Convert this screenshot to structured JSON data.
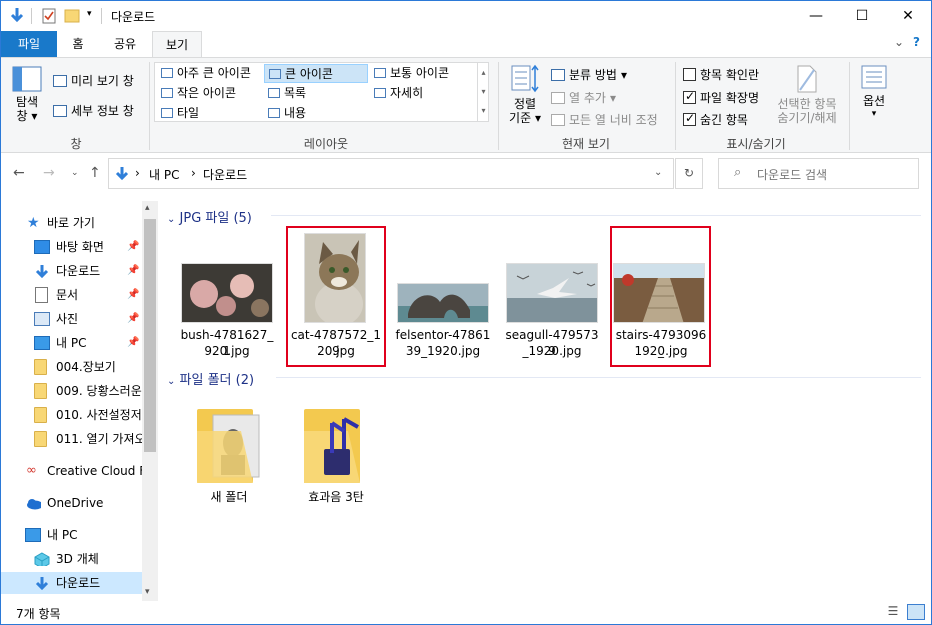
{
  "window": {
    "title": "다운로드",
    "minimize": "—",
    "maximize": "☐",
    "close": "✕"
  },
  "tabs": [
    "파일",
    "홈",
    "공유",
    "보기"
  ],
  "ribbon": {
    "pane": {
      "nav_pane_line1": "탐색",
      "nav_pane_line2": "창",
      "preview": "미리 보기 창",
      "details": "세부 정보 창",
      "label": "창"
    },
    "layout": {
      "items": [
        "아주 큰 아이콘",
        "큰 아이콘",
        "보통 아이콘",
        "작은 아이콘",
        "목록",
        "자세히",
        "타일",
        "내용"
      ],
      "label": "레이아웃"
    },
    "view": {
      "sort_line1": "정렬",
      "sort_line2": "기준",
      "group_by": "분류 방법",
      "add_columns": "열 추가",
      "fit_columns": "모든 열 너비 조정",
      "label": "현재 보기"
    },
    "showhide": {
      "item_checkboxes": "항목 확인란",
      "file_extensions": "파일 확장명",
      "hidden_items": "숨긴 항목",
      "hide_selected_line1": "선택한 항목",
      "hide_selected_line2": "숨기기/해제",
      "label": "표시/숨기기"
    },
    "options": "옵션"
  },
  "address": {
    "segments": [
      "내 PC",
      "다운로드"
    ],
    "separator": "›",
    "search_placeholder": "다운로드 검색"
  },
  "navpane": {
    "items": [
      {
        "label": "바로 가기",
        "icon": "star-icon"
      },
      {
        "label": "바탕 화면",
        "icon": "desktop-icon",
        "pinned": true
      },
      {
        "label": "다운로드",
        "icon": "download-icon",
        "pinned": true
      },
      {
        "label": "문서",
        "icon": "document-icon",
        "pinned": true
      },
      {
        "label": "사진",
        "icon": "pictures-icon",
        "pinned": true
      },
      {
        "label": "내 PC",
        "icon": "pc-icon",
        "pinned": true
      },
      {
        "label": "004.장보기",
        "icon": "folder-icon"
      },
      {
        "label": "009. 당황스러운",
        "icon": "folder-icon"
      },
      {
        "label": "010. 사전설정저",
        "icon": "folder-icon"
      },
      {
        "label": "011. 열기 가져오",
        "icon": "folder-icon"
      },
      {
        "label": "Creative Cloud Fil",
        "icon": "creative-cloud-icon"
      },
      {
        "label": "OneDrive",
        "icon": "onedrive-icon"
      },
      {
        "label": "내 PC",
        "icon": "pc-icon"
      },
      {
        "label": "3D 개체",
        "icon": "cube-icon"
      },
      {
        "label": "다운로드",
        "icon": "download-icon"
      }
    ]
  },
  "groups": {
    "jpg_header": "JPG 파일 (5)",
    "folder_header": "파일 폴더 (2)"
  },
  "files": [
    {
      "name": "bush-4781627_1920.jpg",
      "line1": "bush-4781627_1",
      "line2": "920.jpg",
      "highlight": false
    },
    {
      "name": "cat-4787572_1920.jpg",
      "line1": "cat-4787572_19",
      "line2": "20.jpg",
      "highlight": true
    },
    {
      "name": "felsentor-4786139_1920.jpg",
      "line1": "felsentor-47861",
      "line2": "39_1920.jpg",
      "highlight": false
    },
    {
      "name": "seagull-4795739_1920.jpg",
      "line1": "seagull-4795739",
      "line2": "_1920.jpg",
      "highlight": false
    },
    {
      "name": "stairs-4793096_1920.jpg",
      "line1": "stairs-4793096_",
      "line2": "1920.jpg",
      "highlight": true
    }
  ],
  "folders": [
    {
      "name": "새 폴더"
    },
    {
      "name": "효과음 3탄"
    }
  ],
  "status": {
    "count": "7개 항목"
  }
}
